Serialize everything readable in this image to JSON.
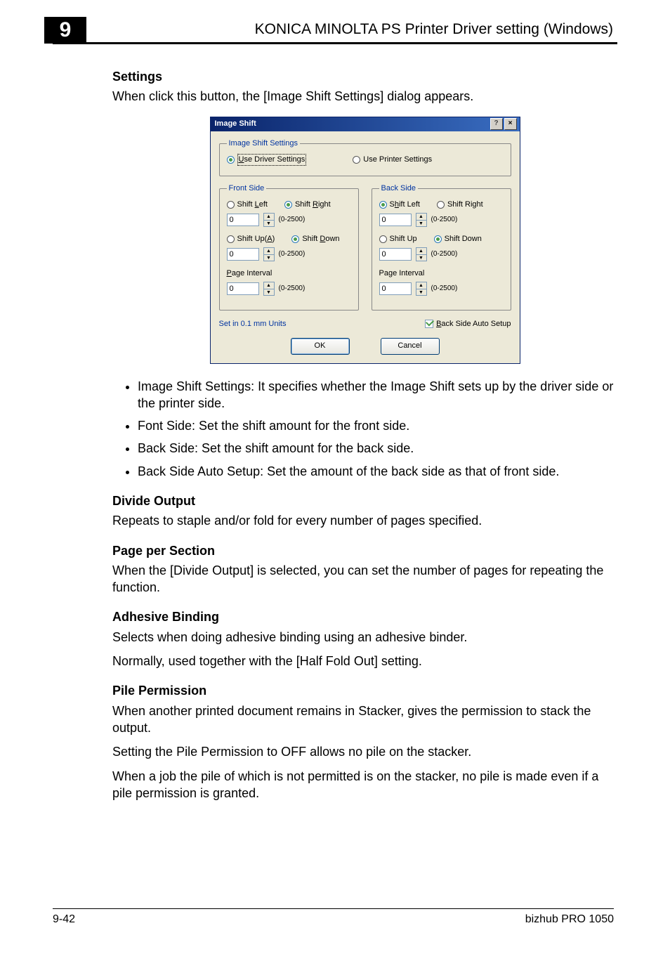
{
  "header": {
    "chapter_number": "9",
    "title": "KONICA MINOLTA PS Printer Driver setting (Windows)"
  },
  "sections": {
    "settings": {
      "heading": "Settings",
      "intro": "When click this button, the [Image Shift Settings] dialog appears."
    },
    "bullets": [
      "Image Shift Settings: It specifies whether the Image Shift sets up by the driver side or the printer side.",
      "Font Side: Set the shift amount for the front side.",
      "Back Side: Set the shift amount for the back side.",
      "Back Side Auto Setup: Set the amount of the back side as that of front side."
    ],
    "divide_output": {
      "heading": "Divide Output",
      "body": "Repeats to staple and/or fold for every number of pages specified."
    },
    "page_per_section": {
      "heading": "Page per Section",
      "body": "When the [Divide Output] is selected, you can set the number of pages for repeating the function."
    },
    "adhesive_binding": {
      "heading": "Adhesive Binding",
      "body1": "Selects when doing adhesive binding using an adhesive binder.",
      "body2": "Normally, used together with the [Half Fold Out] setting."
    },
    "pile_permission": {
      "heading": "Pile Permission",
      "body1": "When another printed document remains in Stacker, gives the permission to stack the output.",
      "body2": "Setting the Pile Permission to OFF allows no pile on the stacker.",
      "body3": "When a job the pile of which is not permitted is on the stacker, no pile is made even if a pile permission is granted."
    }
  },
  "dialog": {
    "title": "Image Shift",
    "window_buttons": {
      "help": "?",
      "close": "×"
    },
    "image_shift_settings": {
      "legend": "Image Shift Settings",
      "use_driver": "se Driver Settings",
      "use_driver_prefix": "U",
      "use_printer": "Use Printer Settings"
    },
    "front_side": {
      "legend": "Front Side",
      "shift_left_prefix": "Shift ",
      "shift_left_accel": "L",
      "shift_left_suffix": "eft",
      "shift_right_prefix": "Shift ",
      "shift_right_accel": "R",
      "shift_right_suffix": "ight",
      "shift_up_prefix": "Shift Up(",
      "shift_up_accel": "A",
      "shift_up_suffix": ")",
      "shift_down_prefix": "Shift ",
      "shift_down_accel": "D",
      "shift_down_suffix": "own",
      "value_lr": "0",
      "value_ud": "0",
      "range": "(0-2500)",
      "page_interval_label_prefix": "",
      "page_interval_accel": "P",
      "page_interval_label_suffix": "age Interval",
      "value_interval": "0"
    },
    "back_side": {
      "legend": "Back Side",
      "shift_left_prefix": "S",
      "shift_left_accel": "h",
      "shift_left_suffix": "ift Left",
      "shift_right": "Shift Right",
      "shift_up": "Shift Up",
      "shift_down": "Shift Down",
      "value_lr": "0",
      "value_ud": "0",
      "range": "(0-2500)",
      "page_interval_label": "Page Interval",
      "value_interval": "0"
    },
    "units_note": "Set in 0.1 mm Units",
    "back_auto_label_prefix": "",
    "back_auto_accel": "B",
    "back_auto_label_suffix": "ack Side Auto Setup",
    "back_auto_checked": true,
    "buttons": {
      "ok": "OK",
      "cancel": "Cancel"
    }
  },
  "footer": {
    "page": "9-42",
    "product": "bizhub PRO 1050"
  }
}
